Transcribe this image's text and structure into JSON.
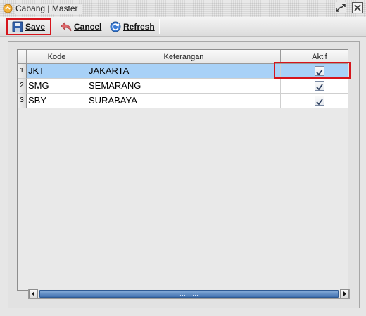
{
  "window": {
    "title": "Cabang | Master",
    "restore_icon": "restore-icon",
    "close_icon": "close-icon"
  },
  "toolbar": {
    "save_label": "Save",
    "cancel_label": "Cancel",
    "refresh_label": "Refresh"
  },
  "grid": {
    "columns": [
      "Kode",
      "Keterangan",
      "Aktif"
    ],
    "rows": [
      {
        "num": "1",
        "kode": "JKT",
        "keterangan": "JAKARTA",
        "aktif": true,
        "selected": true
      },
      {
        "num": "2",
        "kode": "SMG",
        "keterangan": "SEMARANG",
        "aktif": true,
        "selected": false
      },
      {
        "num": "3",
        "kode": "SBY",
        "keterangan": "SURABAYA",
        "aktif": true,
        "selected": false
      }
    ]
  },
  "colors": {
    "selection": "#a8d1f7",
    "highlight": "#d6151c",
    "scroll_thumb": "#3f6fae"
  }
}
